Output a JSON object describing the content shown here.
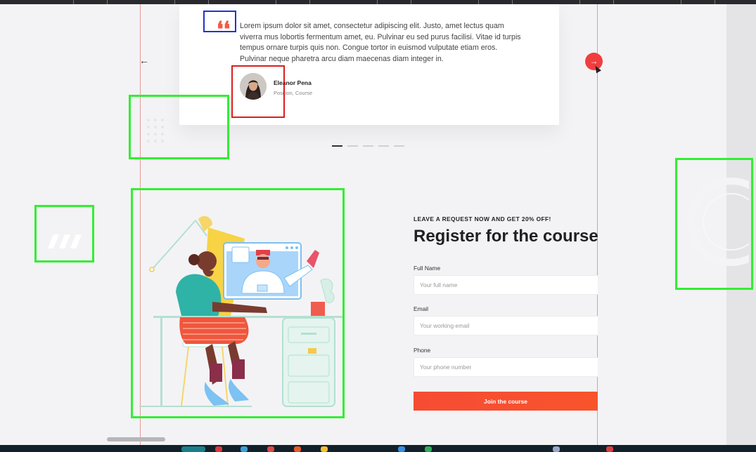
{
  "testimonial": {
    "quote_text": "Lorem ipsum dolor sit amet, consectetur adipiscing elit. Justo, amet lectus quam viverra mus lobortis fermentum amet, eu. Pulvinar eu sed purus facilisi. Vitae id turpis tempus ornare turpis quis non. Congue tortor in euismod vulputate etiam eros. Pulvinar neque pharetra arcu diam maecenas diam integer in.",
    "quote_mark": "❛❛",
    "author_name": "Eleanor Pena",
    "author_role": "Position, Course",
    "prev_arrow": "←",
    "next_arrow": "→",
    "slide_count": 5,
    "active_slide": 1
  },
  "register": {
    "eyebrow": "LEAVE A REQUEST NOW AND GET 20% OFF!",
    "title": "Register for the course",
    "fields": {
      "full_name": {
        "label": "Full Name",
        "placeholder": "Your full name"
      },
      "email": {
        "label": "Email",
        "placeholder": "Your working email"
      },
      "phone": {
        "label": "Phone",
        "placeholder": "Your phone number"
      }
    },
    "submit_label": "Join the course"
  },
  "colors": {
    "accent": "#f03e3e",
    "button_gradient_start": "#f64c34",
    "button_gradient_end": "#f8542c",
    "page_background": "#f3f3f5",
    "highlight_green": "#33ee33",
    "highlight_blue": "#2233cc",
    "highlight_red": "#dd1c1c"
  },
  "icons": [
    "quote-icon",
    "arrow-left-icon",
    "arrow-right-icon",
    "cursor-icon",
    "avatar-portrait",
    "study-illustration"
  ]
}
